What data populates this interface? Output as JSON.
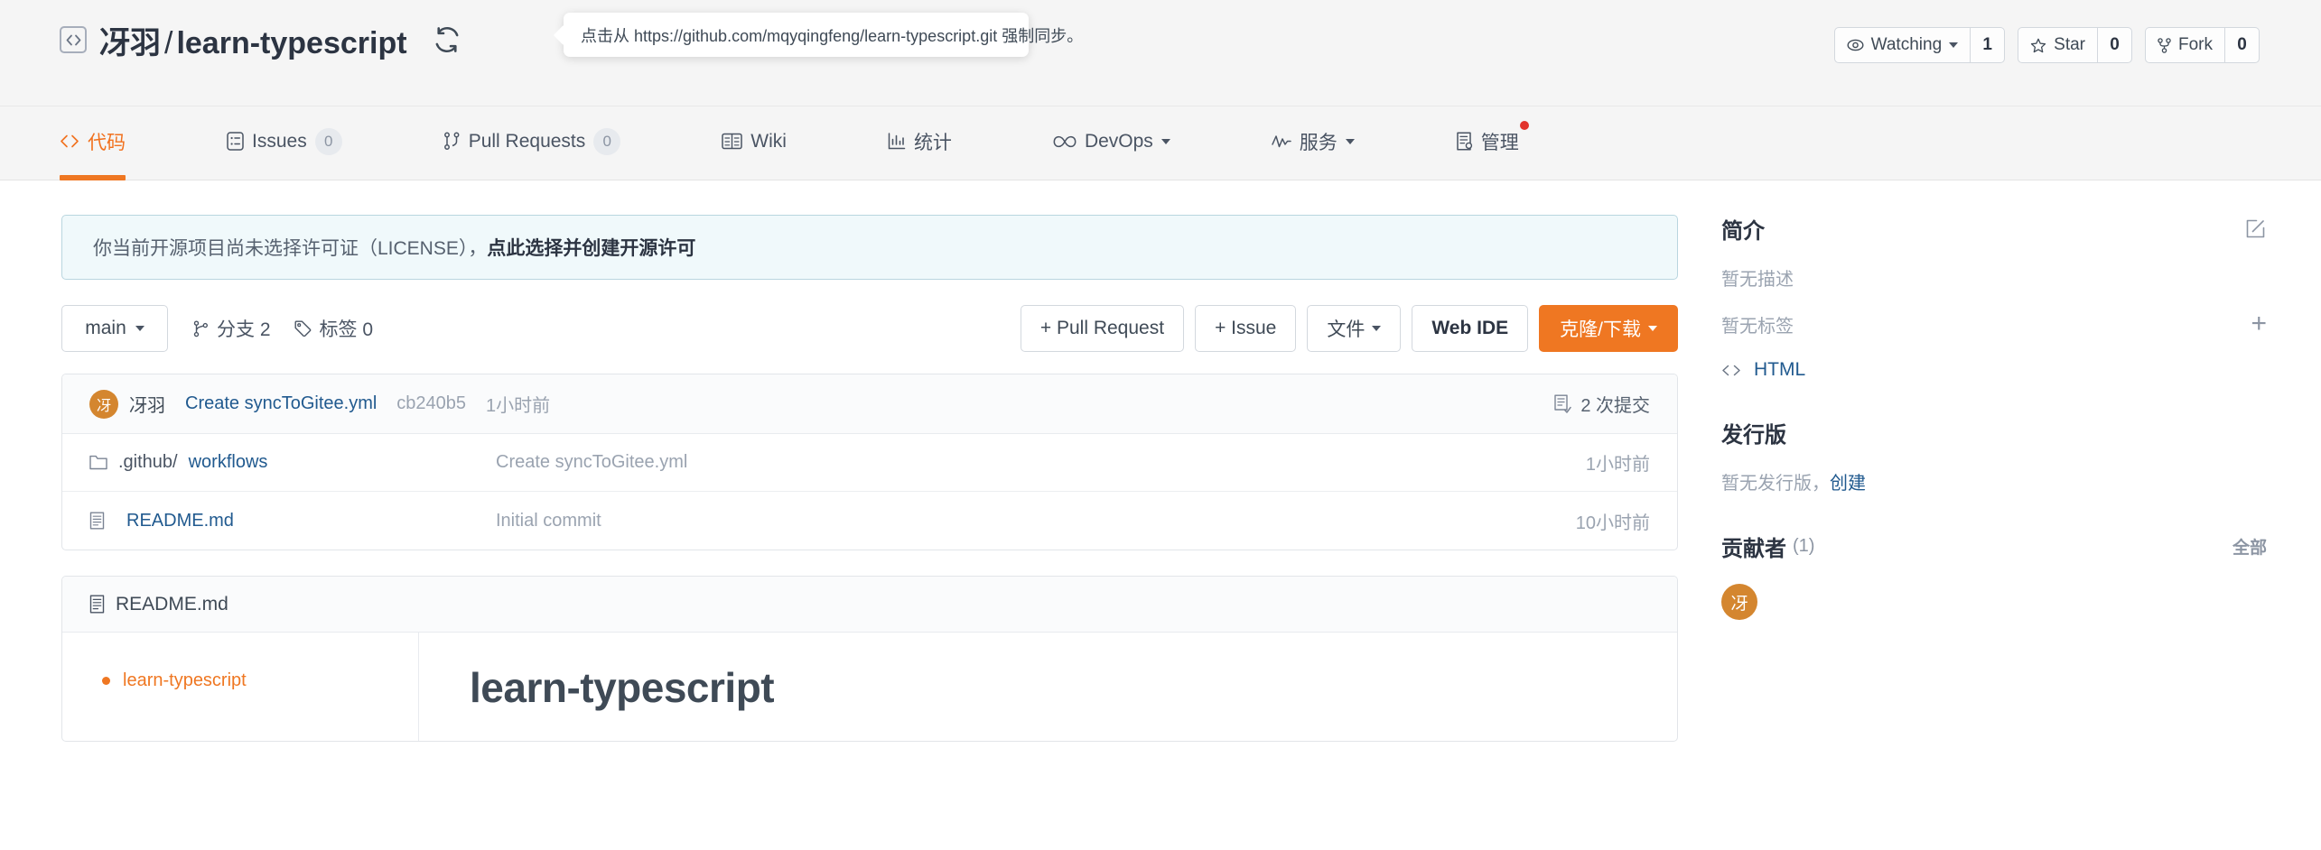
{
  "header": {
    "repo_icon": "code-square-icon",
    "owner": "冴羽",
    "separator": "/",
    "repo": "learn-typescript",
    "sync_icon": "sync-icon",
    "tooltip": "点击从 https://github.com/mqyqingfeng/learn-typescript.git 强制同步。",
    "actions": [
      {
        "icon": "eye-icon",
        "label": "Watching",
        "has_caret": true,
        "count": "1"
      },
      {
        "icon": "star-icon",
        "label": "Star",
        "has_caret": false,
        "count": "0"
      },
      {
        "icon": "fork-icon",
        "label": "Fork",
        "has_caret": false,
        "count": "0"
      }
    ]
  },
  "nav": {
    "items": [
      {
        "icon": "code-icon",
        "label": "代码",
        "count": null,
        "active": true,
        "caret": false,
        "dot": false
      },
      {
        "icon": "issue-icon",
        "label": "Issues",
        "count": "0",
        "active": false,
        "caret": false,
        "dot": false
      },
      {
        "icon": "pull-request-icon",
        "label": "Pull Requests",
        "count": "0",
        "active": false,
        "caret": false,
        "dot": false
      },
      {
        "icon": "book-icon",
        "label": "Wiki",
        "count": null,
        "active": false,
        "caret": false,
        "dot": false
      },
      {
        "icon": "chart-icon",
        "label": "统计",
        "count": null,
        "active": false,
        "caret": false,
        "dot": false
      },
      {
        "icon": "infinity-icon",
        "label": "DevOps",
        "count": null,
        "active": false,
        "caret": true,
        "dot": false
      },
      {
        "icon": "pulse-icon",
        "label": "服务",
        "count": null,
        "active": false,
        "caret": true,
        "dot": false
      },
      {
        "icon": "settings-doc-icon",
        "label": "管理",
        "count": null,
        "active": false,
        "caret": false,
        "dot": true
      }
    ]
  },
  "license_banner": {
    "text": "你当前开源项目尚未选择许可证（LICENSE），",
    "link": "点此选择并创建开源许可"
  },
  "toolbar": {
    "branch": "main",
    "branches_icon": "branch-icon",
    "branches_label": "分支 2",
    "tags_icon": "tag-icon",
    "tags_label": "标签 0",
    "pull_request_btn": "+ Pull Request",
    "issue_btn": "+ Issue",
    "files_btn": "文件",
    "web_ide_btn": "Web IDE",
    "clone_btn": "克隆/下载"
  },
  "commit_bar": {
    "avatar_initial": "冴",
    "author": "冴羽",
    "message": "Create syncToGitee.yml",
    "sha": "cb240b5",
    "time": "1小时前",
    "commits_icon": "commit-list-icon",
    "commits_label": "2 次提交"
  },
  "files": [
    {
      "icon": "folder-icon",
      "name_prefix": ".github/",
      "name_link": "workflows",
      "commit": "Create syncToGitee.yml",
      "time": "1小时前"
    },
    {
      "icon": "file-icon",
      "name_prefix": "",
      "name_link": "README.md",
      "commit": "Initial commit",
      "time": "10小时前"
    }
  ],
  "readme": {
    "icon": "file-icon",
    "filename": "README.md",
    "toc": [
      "learn-typescript"
    ],
    "heading": "learn-typescript"
  },
  "sidebar": {
    "about": {
      "title": "简介",
      "edit_icon": "edit-square-icon",
      "description": "暂无描述",
      "tags": "暂无标签",
      "add_tag_icon": "plus-icon",
      "language_icon": "code-icon",
      "language": "HTML"
    },
    "releases": {
      "title": "发行版",
      "empty_text": "暂无发行版，",
      "create_link": "创建"
    },
    "contributors": {
      "title": "贡献者",
      "count": "(1)",
      "all_link": "全部",
      "avatars": [
        {
          "initial": "冴"
        }
      ]
    }
  },
  "colors": {
    "accent_orange": "#ef7722",
    "link_blue": "#215a8f",
    "text_dark": "#2c3442",
    "muted": "#9aa3b0",
    "banner_bg": "#f0f9fb",
    "banner_border": "#b9d6df",
    "avatar_bg": "#d4862f",
    "dot_red": "#e2342d"
  }
}
